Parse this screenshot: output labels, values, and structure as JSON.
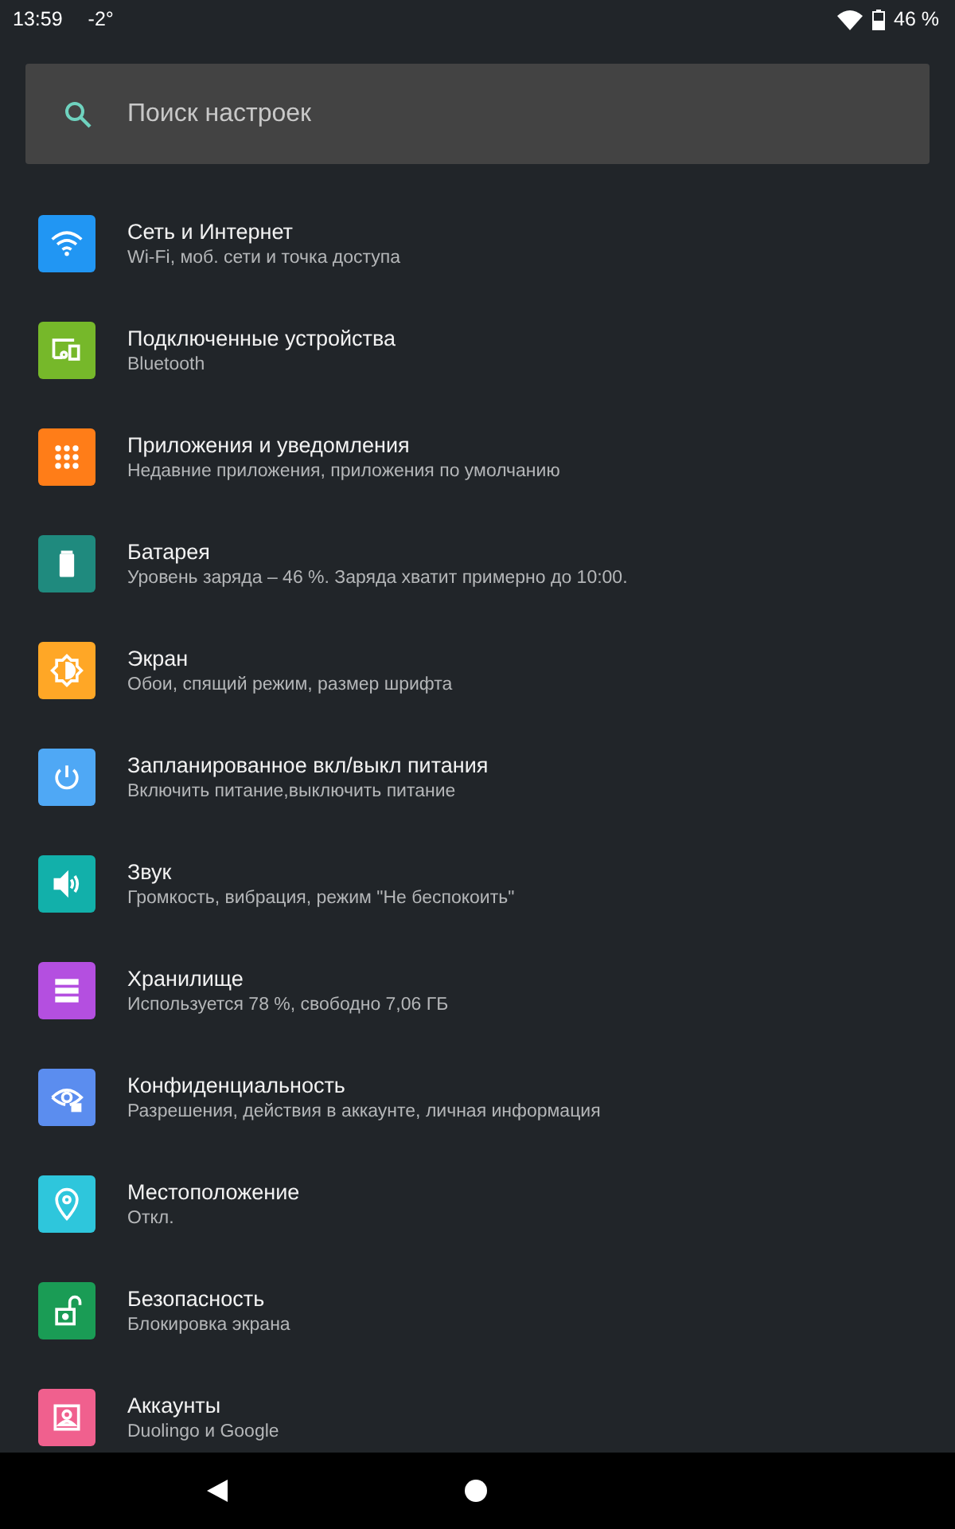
{
  "status_bar": {
    "time": "13:59",
    "temperature": "-2°",
    "battery": "46 %"
  },
  "search": {
    "placeholder": "Поиск настроек"
  },
  "items": [
    {
      "kind": "wifi",
      "color": "#2196f3",
      "title": "Сеть и Интернет",
      "subtitle": "Wi-Fi, моб. сети и точка доступа"
    },
    {
      "kind": "devices",
      "color": "#76b82a",
      "title": "Подключенные устройства",
      "subtitle": "Bluetooth"
    },
    {
      "kind": "apps",
      "color": "#ff7d18",
      "title": "Приложения и уведомления",
      "subtitle": "Недавние приложения, приложения по умолчанию"
    },
    {
      "kind": "battery",
      "color": "#1f8a7e",
      "title": "Батарея",
      "subtitle": "Уровень заряда – 46 %. Заряда хватит примерно до 10:00."
    },
    {
      "kind": "display",
      "color": "#ffa726",
      "title": "Экран",
      "subtitle": "Обои, спящий режим, размер шрифта"
    },
    {
      "kind": "power",
      "color": "#4fa8f5",
      "title": "Запланированное вкл/выкл питания",
      "subtitle": "Включить питание,выключить питание"
    },
    {
      "kind": "sound",
      "color": "#12b0aa",
      "title": "Звук",
      "subtitle": "Громкость, вибрация, режим \"Не беспокоить\""
    },
    {
      "kind": "storage",
      "color": "#b44fe0",
      "title": "Хранилище",
      "subtitle": "Используется 78 %, свободно 7,06 ГБ"
    },
    {
      "kind": "privacy",
      "color": "#5b8def",
      "title": "Конфиденциальность",
      "subtitle": "Разрешения, действия в аккаунте, личная информация"
    },
    {
      "kind": "location",
      "color": "#2ec6dc",
      "title": "Местоположение",
      "subtitle": "Откл."
    },
    {
      "kind": "security",
      "color": "#1a9c55",
      "title": "Безопасность",
      "subtitle": "Блокировка экрана"
    },
    {
      "kind": "accounts",
      "color": "#f0608e",
      "title": "Аккаунты",
      "subtitle": "Duolingo и Google"
    }
  ]
}
